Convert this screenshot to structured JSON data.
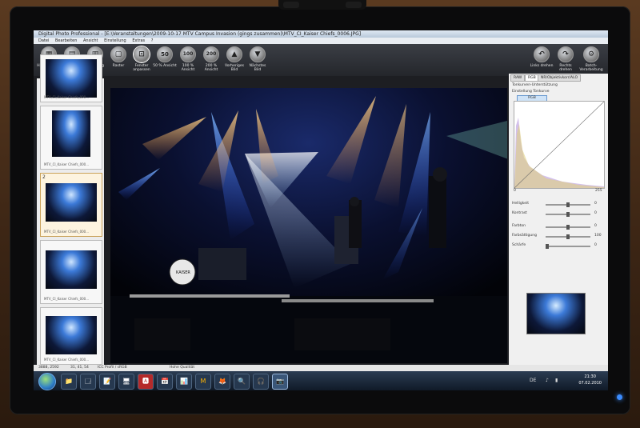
{
  "window": {
    "title": "Digital Photo Professional - [E:\\Veranstaltungen\\2009-10-17 MTV Campus Invasion (gings zusammen)\\MTV_CI_Kaiser Chiefs_0006.JPG]"
  },
  "menu": [
    "Datei",
    "Bearbeiten",
    "Ansicht",
    "Einstellung",
    "Extras",
    "?"
  ],
  "toolbar": [
    {
      "icon": "main-window-icon",
      "glyph": "▦",
      "label": "Hauptfenster"
    },
    {
      "icon": "thumbnails-icon",
      "glyph": "▤",
      "label": "Miniaturansicht"
    },
    {
      "icon": "tool-icon",
      "glyph": "▥",
      "label": "Werkzeug"
    },
    {
      "icon": "frame-icon",
      "glyph": "▢",
      "label": "Raster"
    },
    {
      "icon": "fit-window-icon",
      "glyph": "⊡",
      "label": "Fenster anpassen"
    },
    {
      "icon": "zoom-50-icon",
      "glyph": "50",
      "label": "50 % Ansicht"
    },
    {
      "icon": "zoom-100-icon",
      "glyph": "100",
      "label": "100 % Ansicht"
    },
    {
      "icon": "zoom-200-icon",
      "glyph": "200",
      "label": "200 % Ansicht"
    },
    {
      "icon": "previous-image-icon",
      "glyph": "▲",
      "label": "Vorheriges Bild"
    },
    {
      "icon": "next-image-icon",
      "glyph": "▼",
      "label": "Nächstes Bild"
    }
  ],
  "toolbar_right": [
    {
      "icon": "rotate-left-icon",
      "glyph": "↶",
      "label": "Links drehen"
    },
    {
      "icon": "rotate-right-icon",
      "glyph": "↷",
      "label": "Rechts drehen"
    },
    {
      "icon": "batch-processing-icon",
      "glyph": "⚙",
      "label": "Batch-Verarbeitung"
    }
  ],
  "thumbnails": [
    {
      "caption": "MTV_CI_Kaiser Chiefs_000..."
    },
    {
      "caption": "MTV_CI_Kaiser Chiefs_000..."
    },
    {
      "number": "2",
      "caption": "MTV_CI_Kaiser Chiefs_000..."
    },
    {
      "caption": "MTV_CI_Kaiser Chiefs_000..."
    },
    {
      "caption": "MTV_CI_Kaiser Chiefs_000..."
    }
  ],
  "right_panel": {
    "tabs": [
      "RAW",
      "RGB",
      "NR/Objektivkorr/ALO"
    ],
    "tone_curve_label": "Tonkurven-Unterstützung",
    "tone_setting_label": "Einstellung Tonkurve",
    "channel_label": "RGB",
    "sliders": [
      {
        "label": "Helligkeit",
        "value": "0"
      },
      {
        "label": "Kontrast",
        "value": "0"
      },
      {
        "label": "Farbton",
        "value": "0"
      },
      {
        "label": "Farbsättigung",
        "value": "100"
      },
      {
        "label": "Schärfe",
        "value": "0"
      }
    ],
    "hist_min": "0",
    "hist_max": "255"
  },
  "status": {
    "dimensions": "3888, 2592",
    "coords": "31, 41, 54",
    "profile": "ICC Profil / sRGB",
    "quality": "Hohe Qualität"
  },
  "taskbar": {
    "time": "21:30",
    "date": "07.02.2010",
    "lang": "DE",
    "apps": [
      "📁",
      "🗔",
      "📝",
      "🖥",
      "🅰",
      "📅",
      "📊",
      "M",
      "🦊",
      "🔍",
      "🎧",
      "📷"
    ]
  }
}
